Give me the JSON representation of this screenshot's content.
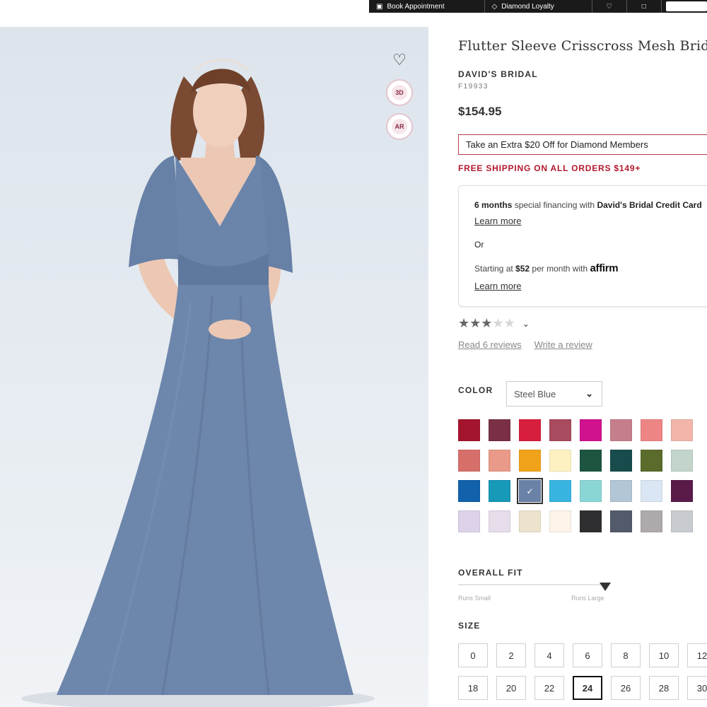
{
  "topbar": {
    "book_label": "Book Appointment",
    "loyalty_label": "Diamond Loyalty"
  },
  "product": {
    "title": "Flutter Sleeve Crisscross Mesh Bridesmaid Dress",
    "brand": "DAVID'S BRIDAL",
    "sku": "F19933",
    "price": "$154.95"
  },
  "hero": {
    "btn_3d": "3D",
    "btn_ar": "AR"
  },
  "promo": {
    "diamond": "Take an Extra $20 Off for Diamond Members",
    "shipping": "FREE SHIPPING ON ALL ORDERS $149+"
  },
  "financing": {
    "months": "6 months",
    "special_text": "special financing with",
    "card_name": "David's Bridal Credit Card",
    "learn_more_1": "Learn more",
    "or": "Or",
    "starting": "Starting at",
    "monthly": "$52",
    "per_month": "per month with",
    "affirm": "affirm",
    "learn_more_2": "Learn more"
  },
  "reviews": {
    "rating": 3,
    "max": 5,
    "read": "Read 6 reviews",
    "write": "Write a review"
  },
  "color": {
    "label": "COLOR",
    "selected": "Steel Blue",
    "swatches": [
      "#a3152e",
      "#7a2f45",
      "#d81e3e",
      "#a94a5f",
      "#d0128f",
      "#c57f8c",
      "#ee8585",
      "#f2b5aa",
      "#d66f6a",
      "#ea9a88",
      "#f0a31a",
      "#fdf0c1",
      "#1d5540",
      "#184b4c",
      "#5a6b2b",
      "#c3d5cb",
      "#1161ab",
      "#1799b8",
      "#6b82a8",
      "#38b4e1",
      "#8ad6d6",
      "#b2c6d6",
      "#dbe6f4",
      "#5a1b4a",
      "#ddd2ea",
      "#e6dcea",
      "#ede3cc",
      "#fcf4e8",
      "#2f2f31",
      "#535a6a",
      "#aeaaac",
      "#c8ccd0"
    ],
    "selected_index": 18
  },
  "fit": {
    "label": "OVERALL FIT",
    "low": "Runs Small",
    "high": "Runs Large",
    "level": 1.0
  },
  "size": {
    "label": "SIZE",
    "options": [
      "0",
      "2",
      "4",
      "6",
      "8",
      "10",
      "12",
      "18",
      "20",
      "22",
      "24",
      "26",
      "28",
      "30"
    ],
    "selected": "24"
  }
}
